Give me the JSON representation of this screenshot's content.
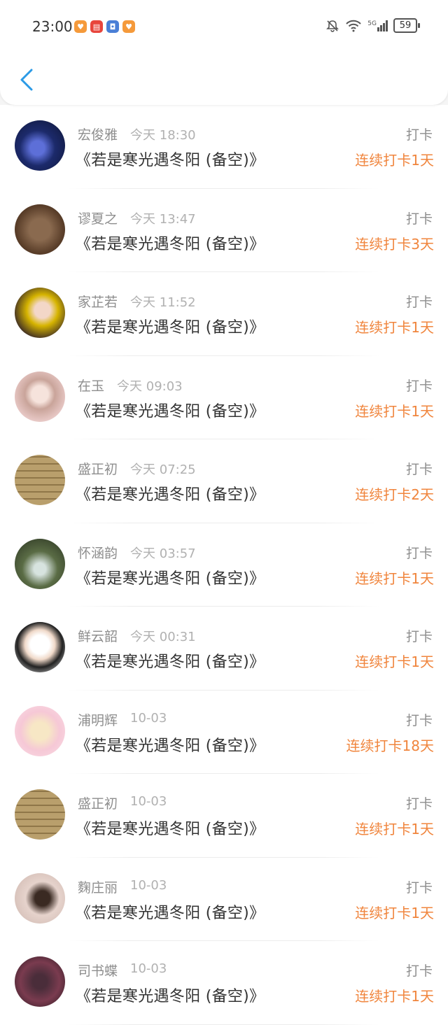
{
  "status_bar": {
    "time": "23:00",
    "network": "5G",
    "battery": "59",
    "notif_icons": [
      "heart-app-icon",
      "book-app-icon",
      "badge-app-icon",
      "heart-app-icon-2"
    ]
  },
  "colors": {
    "accent": "#f0853d",
    "back": "#2b9ae6"
  },
  "entries": [
    {
      "name": "宏俊雅",
      "time": "今天 18:30",
      "title": "《若是寒光遇冬阳 (备空)》",
      "action": "打卡",
      "streak": "连续打卡1天"
    },
    {
      "name": "谬夏之",
      "time": "今天 13:47",
      "title": "《若是寒光遇冬阳 (备空)》",
      "action": "打卡",
      "streak": "连续打卡3天"
    },
    {
      "name": "家芷若",
      "time": "今天 11:52",
      "title": "《若是寒光遇冬阳 (备空)》",
      "action": "打卡",
      "streak": "连续打卡1天"
    },
    {
      "name": "在玉",
      "time": "今天 09:03",
      "title": "《若是寒光遇冬阳 (备空)》",
      "action": "打卡",
      "streak": "连续打卡1天"
    },
    {
      "name": "盛正初",
      "time": "今天 07:25",
      "title": "《若是寒光遇冬阳 (备空)》",
      "action": "打卡",
      "streak": "连续打卡2天"
    },
    {
      "name": "怀涵韵",
      "time": "今天 03:57",
      "title": "《若是寒光遇冬阳 (备空)》",
      "action": "打卡",
      "streak": "连续打卡1天"
    },
    {
      "name": "鲜云韶",
      "time": "今天 00:31",
      "title": "《若是寒光遇冬阳 (备空)》",
      "action": "打卡",
      "streak": "连续打卡1天"
    },
    {
      "name": "浦明辉",
      "time": "10-03",
      "title": "《若是寒光遇冬阳 (备空)》",
      "action": "打卡",
      "streak": "连续打卡18天"
    },
    {
      "name": "盛正初",
      "time": "10-03",
      "title": "《若是寒光遇冬阳 (备空)》",
      "action": "打卡",
      "streak": "连续打卡1天"
    },
    {
      "name": "麴庄丽",
      "time": "10-03",
      "title": "《若是寒光遇冬阳 (备空)》",
      "action": "打卡",
      "streak": "连续打卡1天"
    },
    {
      "name": "司书蝶",
      "time": "10-03",
      "title": "《若是寒光遇冬阳 (备空)》",
      "action": "打卡",
      "streak": "连续打卡1天"
    }
  ]
}
